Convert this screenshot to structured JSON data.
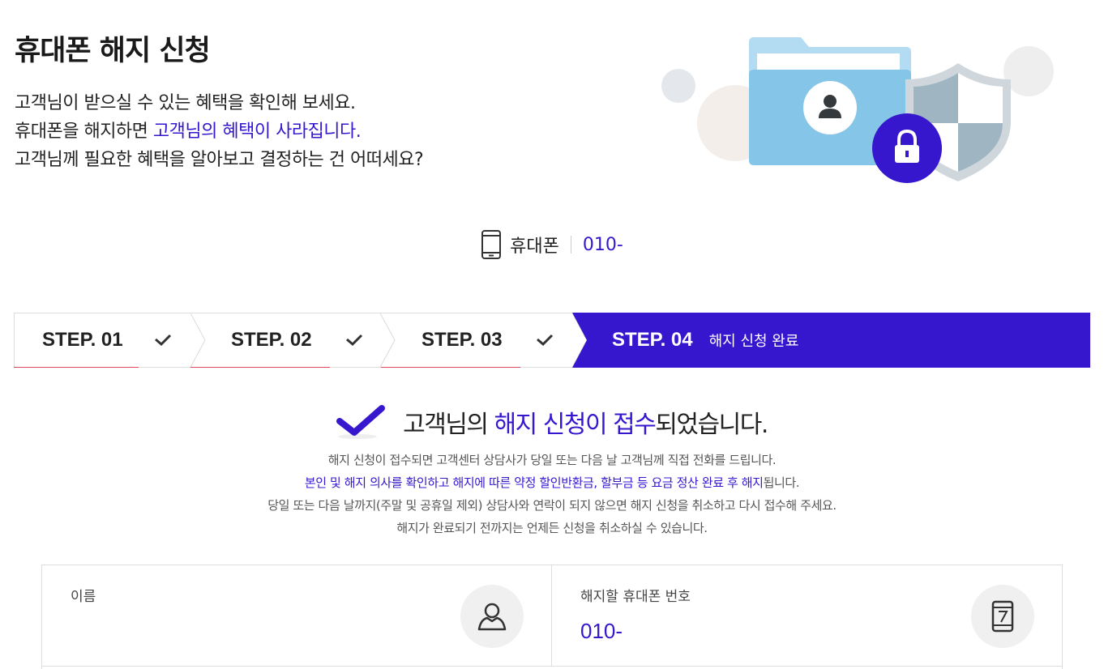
{
  "hero": {
    "title": "휴대폰 해지 신청",
    "line1": "고객님이 받으실 수 있는 혜택을 확인해 보세요.",
    "line2_prefix": "휴대폰을 해지하면 ",
    "line2_highlight": "고객님의 혜택이 사라집니다.",
    "line3": "고객님께 필요한 혜택을 알아보고 결정하는 건 어떠세요?",
    "illustration_icons": [
      "folder-icon",
      "user-icon",
      "lock-icon",
      "shield-icon"
    ]
  },
  "phone_line": {
    "icon": "mobile-phone-icon",
    "label": "휴대폰",
    "number": "010-"
  },
  "steps": [
    {
      "label": "STEP. 01",
      "status": "completed",
      "icon": "check-icon"
    },
    {
      "label": "STEP. 02",
      "status": "completed",
      "icon": "check-icon"
    },
    {
      "label": "STEP. 03",
      "status": "completed",
      "icon": "check-icon"
    },
    {
      "label": "STEP. 04",
      "status": "active",
      "description": "해지 신청 완료"
    }
  ],
  "completion": {
    "icon": "check-mark-icon",
    "prefix": "고객님의 ",
    "highlight": "해지 신청이 접수",
    "suffix": "되었습니다.",
    "notice_line1": "해지 신청이 접수되면 고객센터 상담사가 당일 또는 다음 날 고객님께 직접 전화를 드립니다.",
    "notice_line2_highlight": "본인 및 해지 의사를 확인하고 해지에 따른 약정 할인반환금, 할부금 등 요금 정산 완료 후 해지",
    "notice_line2_suffix": "됩니다.",
    "notice_line3": "당일 또는 다음 날까지(주말 및 공휴일 제외) 상담사와 연락이 되지 않으면 해지 신청을 취소하고 다시 접수해 주세요.",
    "notice_line4": "해지가 완료되기 전까지는 언제든 신청을 취소하실 수 있습니다."
  },
  "info": {
    "name_label": "이름",
    "name_value": "",
    "name_icon": "person-icon",
    "phone_label": "해지할 휴대폰 번호",
    "phone_value": "010-",
    "phone_icon": "smartphone-icon"
  },
  "colors": {
    "accent": "#3617ce",
    "step_underline": "#e14a5c",
    "folder": "#85c6e8",
    "shield": "#9fb6c2"
  }
}
